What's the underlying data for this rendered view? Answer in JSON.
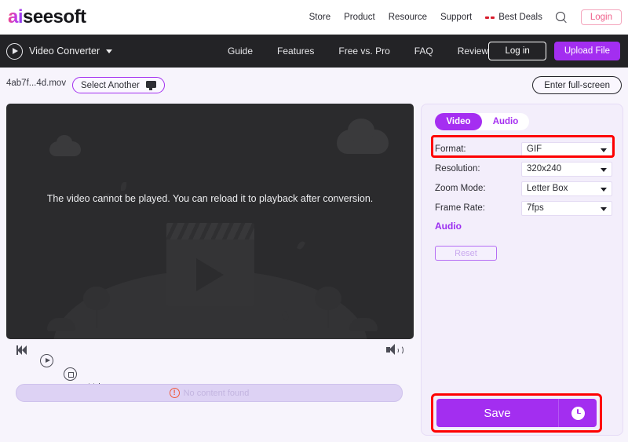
{
  "brand": {
    "logo_accent": "ai",
    "logo_rest": "seesoft",
    "accent_color": "#a32ef0"
  },
  "top_header": {
    "links": [
      "Store",
      "Product",
      "Resource",
      "Support"
    ],
    "best_deals": "Best Deals",
    "search_icon": "search-icon",
    "login_label": "Login"
  },
  "sub_nav": {
    "product": "Video Converter",
    "links": [
      "Guide",
      "Features",
      "Free vs. Pro",
      "FAQ",
      "Review"
    ],
    "login_label": "Log in",
    "upload_label": "Upload File"
  },
  "file_bar": {
    "file_name": "4ab7f...4d.mov",
    "select_another": "Select Another",
    "select_another_icon": "monitor-icon",
    "fullscreen": "Enter full-screen"
  },
  "video": {
    "message": "The video cannot be played. You can reload it to playback after conversion.",
    "controls": [
      "prev-icon",
      "play-icon",
      "stop-icon",
      "next-icon"
    ],
    "volume_icon": "volume-icon",
    "timeline_status": "No content found",
    "timeline_icon": "warning-icon"
  },
  "settings": {
    "tabs": [
      {
        "label": "Video",
        "active": true
      },
      {
        "label": "Audio",
        "active": false
      }
    ],
    "rows": [
      {
        "label": "Format:",
        "value": "GIF"
      },
      {
        "label": "Resolution:",
        "value": "320x240"
      },
      {
        "label": "Zoom Mode:",
        "value": "Letter Box"
      },
      {
        "label": "Frame Rate:",
        "value": "7fps"
      }
    ],
    "audio_heading": "Audio",
    "reset_label": "Reset"
  },
  "save": {
    "label": "Save",
    "clock_icon": "clock-icon"
  },
  "annotations": {
    "highlight_color": "#fe0000"
  }
}
